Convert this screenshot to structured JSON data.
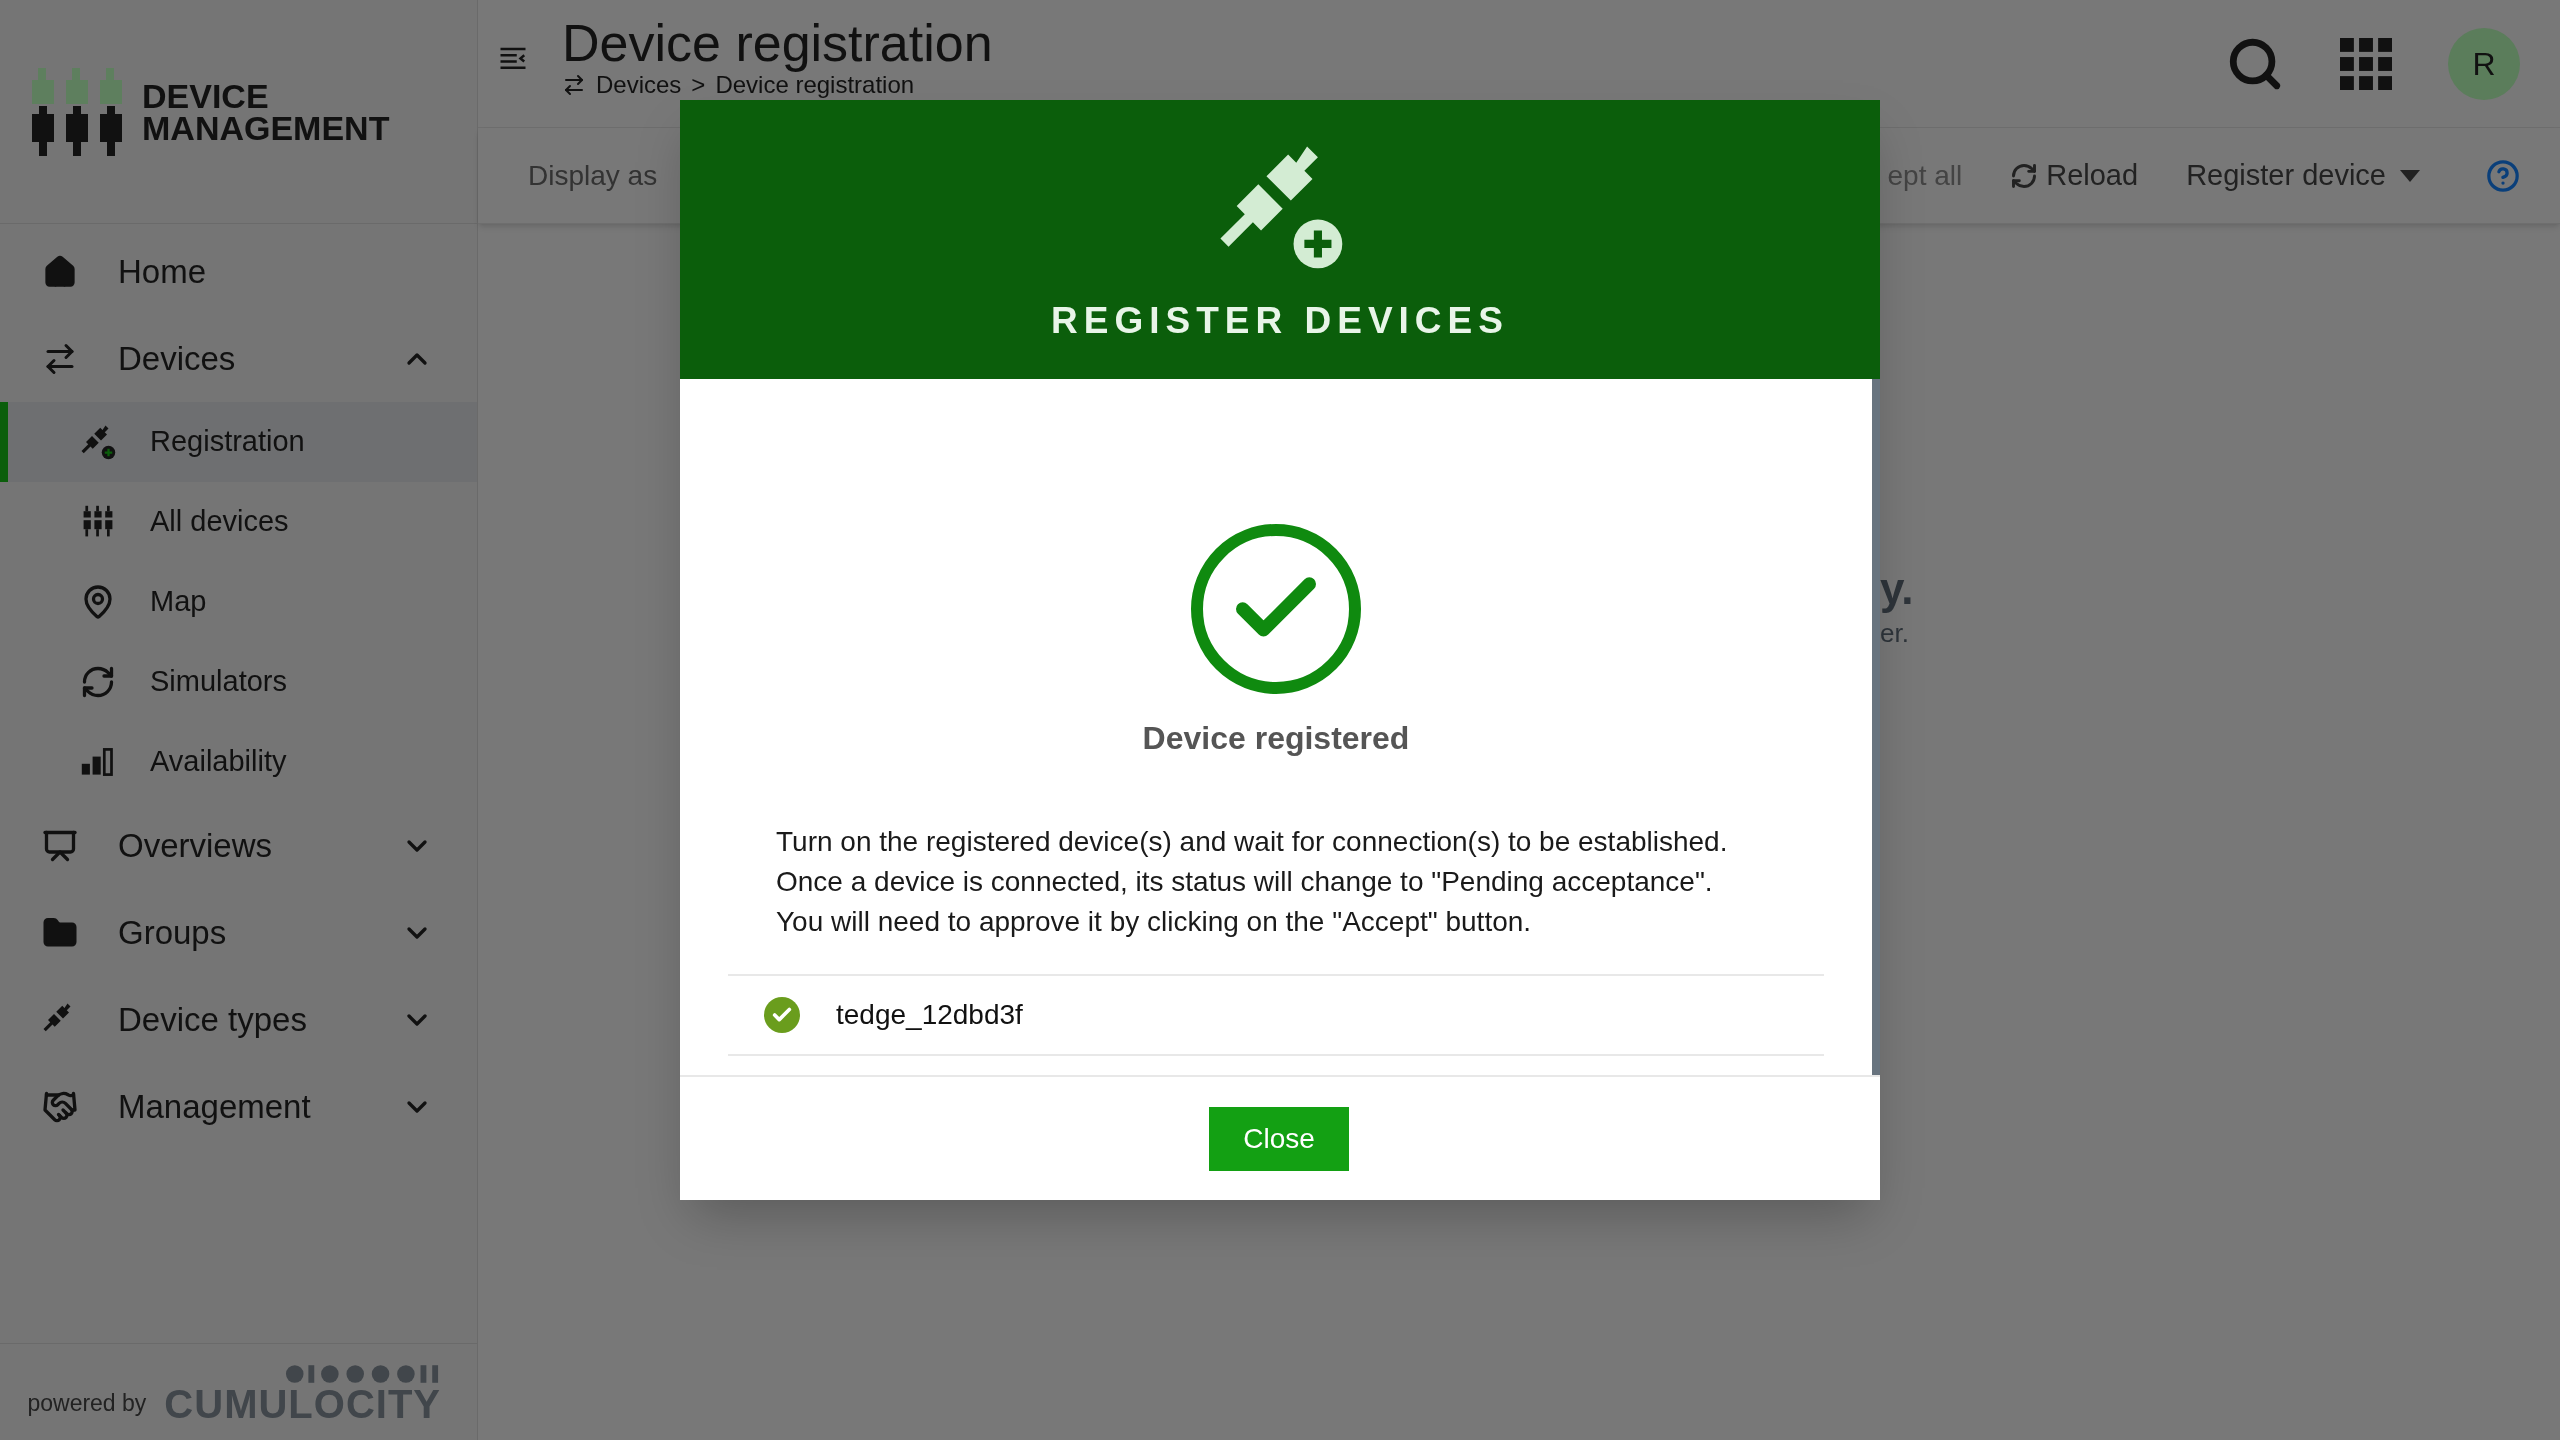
{
  "app": {
    "logo_line1": "DEVICE",
    "logo_line2": "MANAGEMENT"
  },
  "header": {
    "title": "Device registration",
    "breadcrumb": [
      "Devices",
      "Device registration"
    ],
    "separator": ">",
    "avatar": "R"
  },
  "sidebar": {
    "items": [
      {
        "label": "Home",
        "kind": "link"
      },
      {
        "label": "Devices",
        "kind": "group",
        "expanded": true,
        "children": [
          {
            "label": "Registration",
            "selected": true
          },
          {
            "label": "All devices",
            "selected": false
          },
          {
            "label": "Map",
            "selected": false
          },
          {
            "label": "Simulators",
            "selected": false
          },
          {
            "label": "Availability",
            "selected": false
          }
        ]
      },
      {
        "label": "Overviews",
        "kind": "group",
        "expanded": false
      },
      {
        "label": "Groups",
        "kind": "group",
        "expanded": false
      },
      {
        "label": "Device types",
        "kind": "group",
        "expanded": false
      },
      {
        "label": "Management",
        "kind": "group",
        "expanded": false
      }
    ],
    "footer": {
      "powered_by": "powered by",
      "brand": "CUMULOCITY"
    }
  },
  "toolbar": {
    "display_as": "Display as",
    "accept_all": "ept all",
    "reload": "Reload",
    "register": "Register device"
  },
  "background_text": [
    "y.",
    "er."
  ],
  "modal": {
    "title": "REGISTER DEVICES",
    "status": "Device registered",
    "message": [
      "Turn on the registered device(s) and wait for connection(s) to be established.",
      "Once a device is connected, its status will change to \"Pending acceptance\".",
      "You will need to approve it by clicking on the \"Accept\" button."
    ],
    "devices": [
      {
        "name": "tedge_12dbd3f",
        "registered": true
      }
    ],
    "close": "Close"
  }
}
